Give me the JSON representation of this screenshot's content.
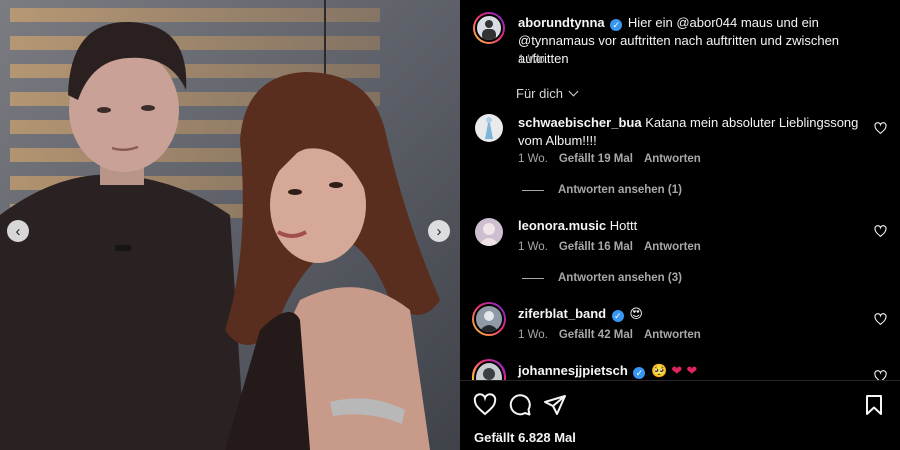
{
  "media": {
    "prev_icon": "chevron-left-icon",
    "next_icon": "chevron-right-icon",
    "prev_glyph": "‹",
    "next_glyph": "›"
  },
  "post": {
    "author": "aborundtynna",
    "verified": true,
    "caption_part1": "Hier ein ",
    "mention1": "@abor044",
    "caption_part2": " maus und ein ",
    "mention2": "@tynnamaus",
    "caption_part3": " vor auftritten nach auftritten und zwischen auftritten",
    "age": "1 Wo."
  },
  "sort": {
    "label": "Für dich"
  },
  "comments": [
    {
      "user": "schwaebischer_bua",
      "verified": false,
      "text": "Katana mein absoluter Lieblingssong vom Album!!!!",
      "age": "1 Wo.",
      "likes": "Gefällt 19 Mal",
      "reply": "Antworten",
      "view_replies": "Antworten ansehen (1)"
    },
    {
      "user": "leonora.music",
      "verified": false,
      "text": "Hottt",
      "age": "1 Wo.",
      "likes": "Gefällt 16 Mal",
      "reply": "Antworten",
      "view_replies": "Antworten ansehen (3)"
    },
    {
      "user": "ziferblat_band",
      "verified": true,
      "text": "😍",
      "age": "1 Wo.",
      "likes": "Gefällt 42 Mal",
      "reply": "Antworten"
    },
    {
      "user": "johannesjjpietsch",
      "verified": true,
      "text": "🥺 ❤ ❤"
    }
  ],
  "actions": {
    "like_icon": "heart-icon",
    "comment_icon": "comment-icon",
    "share_icon": "send-icon",
    "save_icon": "bookmark-icon",
    "likes_total": "Gefällt 6.828 Mal"
  },
  "colors": {
    "verified": "#3897f0",
    "secondary_text": "#a8a8a8",
    "background": "#000000"
  }
}
